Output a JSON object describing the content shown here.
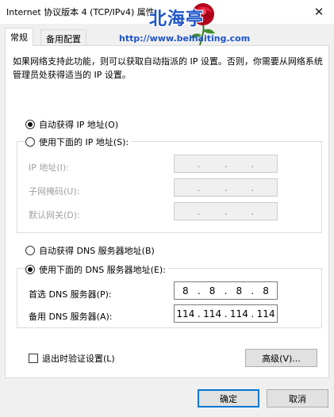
{
  "window": {
    "title": "Internet 协议版本 4 (TCP/IPv4) 属性",
    "close_glyph": "✕"
  },
  "watermark": {
    "title": "北海亭",
    "url": "http://www.beihaiting.com"
  },
  "tabs": [
    {
      "label": "常规",
      "active": true
    },
    {
      "label": "备用配置",
      "active": false
    }
  ],
  "description": "如果网络支持此功能，则可以获取自动指派的 IP 设置。否则，你需要从网络系统管理员处获得适当的 IP 设置。",
  "ip_section": {
    "auto_label": "自动获得 IP 地址(O)",
    "auto_selected": true,
    "manual_label": "使用下面的 IP 地址(S):",
    "manual_selected": false,
    "fields": [
      {
        "label": "IP 地址(I):",
        "value": [
          "",
          "",
          "",
          ""
        ]
      },
      {
        "label": "子网掩码(U):",
        "value": [
          "",
          "",
          "",
          ""
        ]
      },
      {
        "label": "默认网关(D):",
        "value": [
          "",
          "",
          "",
          ""
        ]
      }
    ]
  },
  "dns_section": {
    "auto_label": "自动获得 DNS 服务器地址(B)",
    "auto_selected": false,
    "manual_label": "使用下面的 DNS 服务器地址(E):",
    "manual_selected": true,
    "fields": [
      {
        "label": "首选 DNS 服务器(P):",
        "value": [
          "8",
          "8",
          "8",
          "8"
        ]
      },
      {
        "label": "备用 DNS 服务器(A):",
        "value": [
          "114",
          "114",
          "114",
          "114"
        ]
      }
    ]
  },
  "validate_checkbox": {
    "label": "退出时验证设置(L)",
    "checked": false
  },
  "buttons": {
    "advanced": "高级(V)...",
    "ok": "确定",
    "cancel": "取消"
  }
}
